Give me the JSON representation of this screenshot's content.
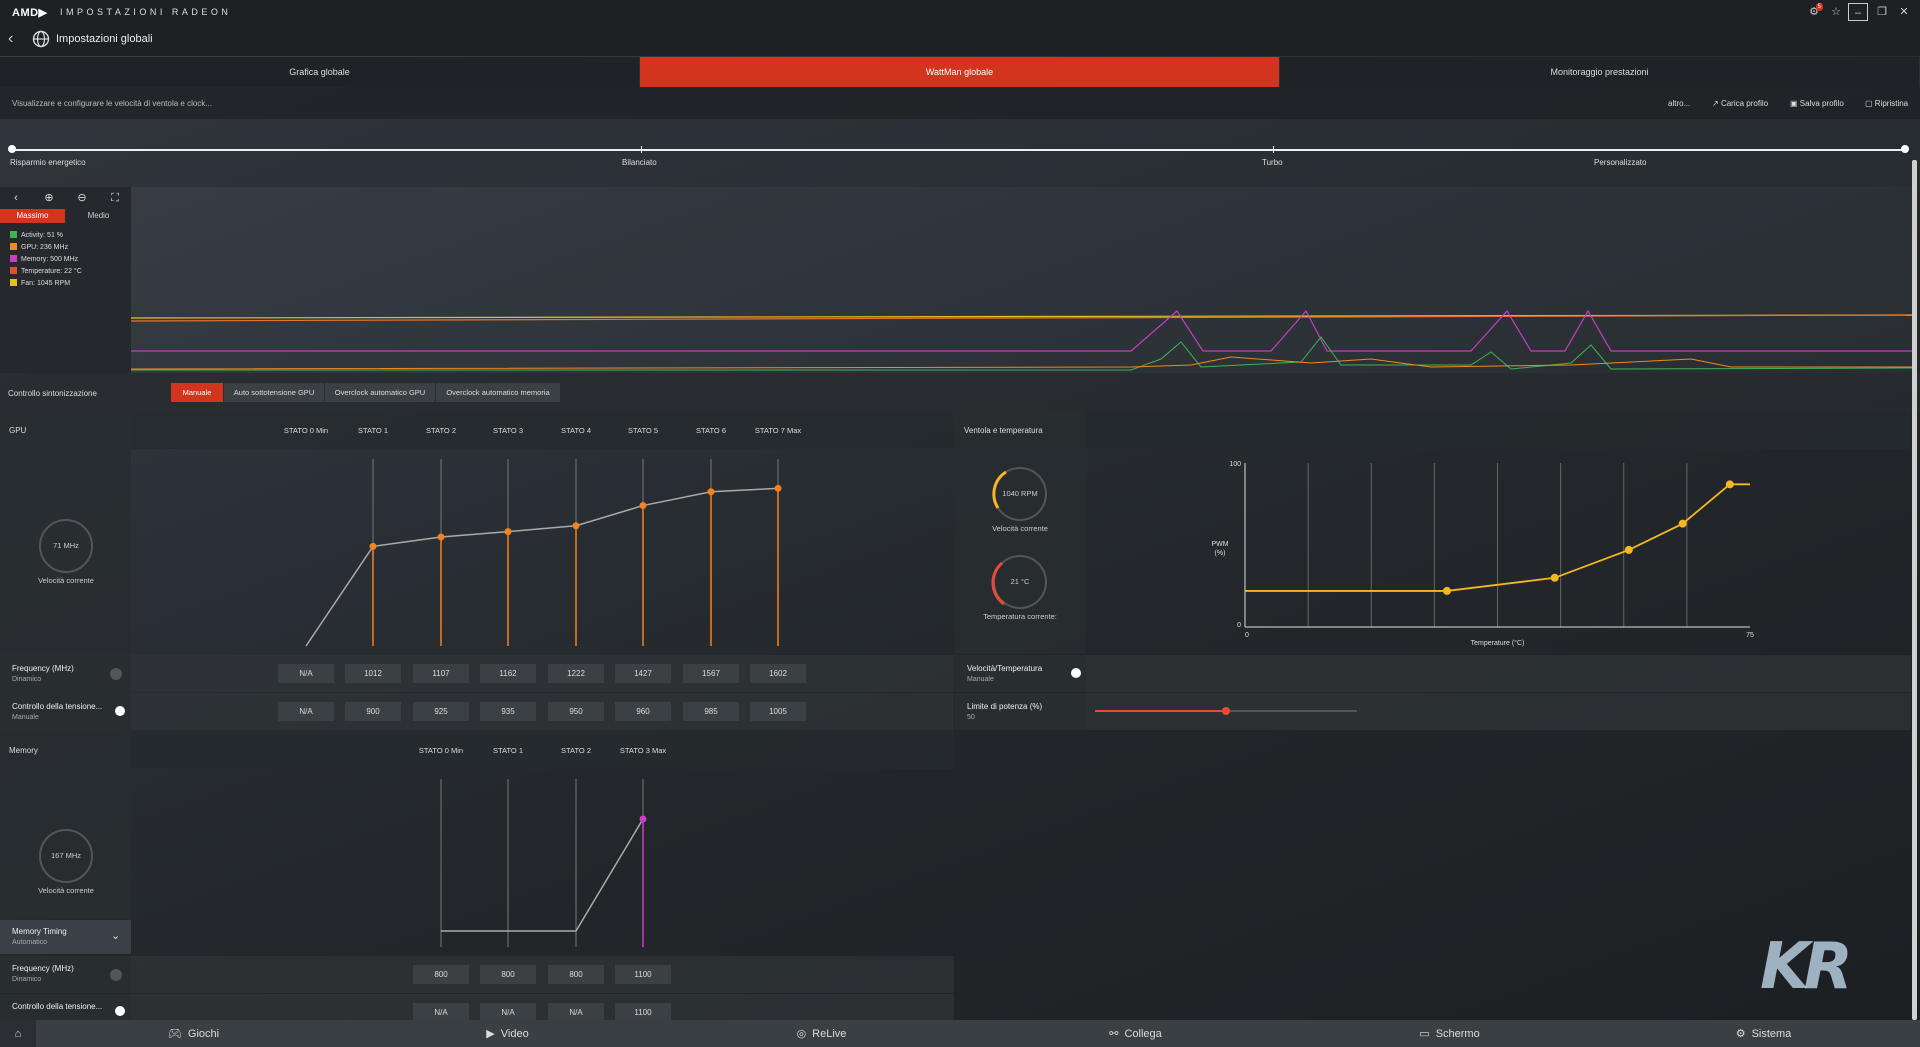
{
  "app": {
    "brand": "AMD▶",
    "title": "IMPOSTAZIONI RADEON",
    "page_title": "Impostazioni globali",
    "notif_badge": "5"
  },
  "tabs": [
    {
      "label": "Grafica globale"
    },
    {
      "label": "WattMan globale"
    },
    {
      "label": "Monitoraggio prestazioni"
    }
  ],
  "subbar": {
    "description": "Visualizzare e configurare le velocità di ventola e clock...",
    "more": "altro...",
    "load": "Carica profilo",
    "save": "Salva profilo",
    "reset": "Ripristina"
  },
  "profiles": [
    "Risparmio energetico",
    "Bilanciato",
    "Turbo",
    "Personalizzato"
  ],
  "monitor": {
    "tab_max": "Massimo",
    "tab_mid": "Medio",
    "legend": [
      {
        "label": "Activity: 51 %",
        "color": "#3fb34f"
      },
      {
        "label": "GPU: 236 MHz",
        "color": "#f08a1e"
      },
      {
        "label": "Memory: 500 MHz",
        "color": "#c43fc4"
      },
      {
        "label": "Temperature: 22 °C",
        "color": "#e84a3a"
      },
      {
        "label": "Fan: 1045 RPM",
        "color": "#e8c020"
      }
    ]
  },
  "tuning": {
    "label": "Controllo sintonizzazione",
    "buttons": [
      "Manuale",
      "Auto sottotensione GPU",
      "Overclock automatico GPU",
      "Overclock automatico memoria"
    ]
  },
  "gpu": {
    "section": "GPU",
    "gauge": "71 MHz",
    "gauge_label": "Velocità corrente",
    "states": [
      "STATO 0 Min",
      "STATO 1",
      "STATO 2",
      "STATO 3",
      "STATO 4",
      "STATO 5",
      "STATO 6",
      "STATO 7 Max"
    ],
    "freq_label": "Frequency (MHz)",
    "freq_sub": "Dinamico",
    "freq": [
      "N/A",
      "1012",
      "1107",
      "1162",
      "1222",
      "1427",
      "1567",
      "1602"
    ],
    "volt_label": "Controllo della tensione...",
    "volt_sub": "Manuale",
    "volt": [
      "N/A",
      "900",
      "925",
      "935",
      "950",
      "960",
      "985",
      "1005"
    ]
  },
  "memory": {
    "section": "Memory",
    "gauge": "167 MHz",
    "gauge_label": "Velocità corrente",
    "states": [
      "STATO 0 Min",
      "STATO 1",
      "STATO 2",
      "STATO 3 Max"
    ],
    "timing_label": "Memory Timing",
    "timing_sub": "Automatico",
    "freq_label": "Frequency (MHz)",
    "freq_sub": "Dinamico",
    "freq": [
      "800",
      "800",
      "800",
      "1100"
    ],
    "volt_label": "Controllo della tensione...",
    "volt": [
      "N/A",
      "N/A",
      "N/A",
      "1100"
    ]
  },
  "fan": {
    "section": "Ventola e temperatura",
    "rpm": "1040 RPM",
    "rpm_label": "Velocità corrente",
    "temp": "21 °C",
    "temp_label": "Temperatura corrente:",
    "vt_label": "Velocità/Temperatura",
    "vt_sub": "Manuale",
    "power_label": "Limite di potenza (%)",
    "power_value": "50",
    "power_fraction": 0.5,
    "ylabel": "PWM\n(%)",
    "y_max": "100",
    "y_min": "0",
    "x_min": "0",
    "x_max": "75",
    "xlabel": "Temperature (°C)"
  },
  "bottom": [
    "Giochi",
    "Video",
    "ReLive",
    "Collega",
    "Schermo",
    "Sistema"
  ],
  "watermark": "KR",
  "colors": {
    "accent": "#d2341e",
    "orange": "#f58220",
    "magenta": "#c840c8",
    "yellow": "#f5b820"
  },
  "chart_data": [
    {
      "type": "line",
      "title": "",
      "series": [
        {
          "name": "",
          "x": [
            0,
            1,
            2,
            3,
            4,
            5,
            6,
            7
          ],
          "y": [
            0,
            1012,
            1107,
            1162,
            1222,
            1427,
            1567,
            1602
          ]
        }
      ]
    },
    {
      "type": "line",
      "title": "",
      "series": [
        {
          "name": "",
          "x": [
            0,
            1,
            2,
            3
          ],
          "y": [
            400,
            400,
            400,
            1100
          ]
        }
      ]
    },
    {
      "type": "line",
      "title": "",
      "xlabel": "Temperature (°C)",
      "ylabel": "PWM (%)",
      "xlim": [
        0,
        75
      ],
      "ylim": [
        0,
        100
      ],
      "series": [
        {
          "name": "",
          "x": [
            0,
            30,
            46,
            57,
            65,
            72,
            75
          ],
          "y": [
            22,
            22,
            30,
            47,
            63,
            87,
            87
          ]
        }
      ]
    }
  ]
}
